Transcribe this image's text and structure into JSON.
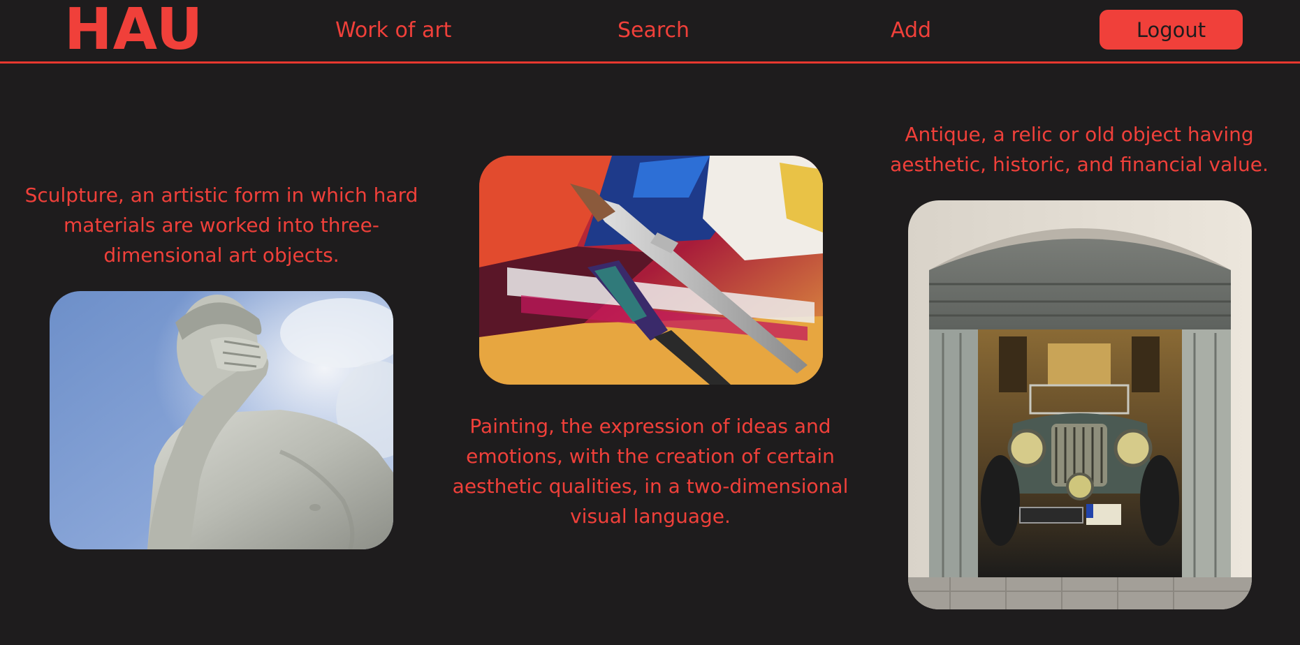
{
  "header": {
    "logo": "HAU",
    "nav": {
      "work_of_art": "Work of art",
      "search": "Search",
      "add": "Add"
    },
    "logout_label": "Logout"
  },
  "gallery": {
    "sculpture": {
      "caption": "Sculpture, an artistic form in which hard materials are worked into three-dimensional art objects.",
      "image": "sculpture-photo"
    },
    "painting": {
      "caption": "Painting, the expression of ideas and emotions, with the creation of certain aesthetic qualities, in a two-dimensional visual language.",
      "image": "painting-photo"
    },
    "antique": {
      "caption": "Antique, a relic or old object having aesthetic, historic, and financial value.",
      "image": "antique-car-photo"
    }
  },
  "colors": {
    "background": "#1e1c1d",
    "accent": "#f0403a"
  }
}
